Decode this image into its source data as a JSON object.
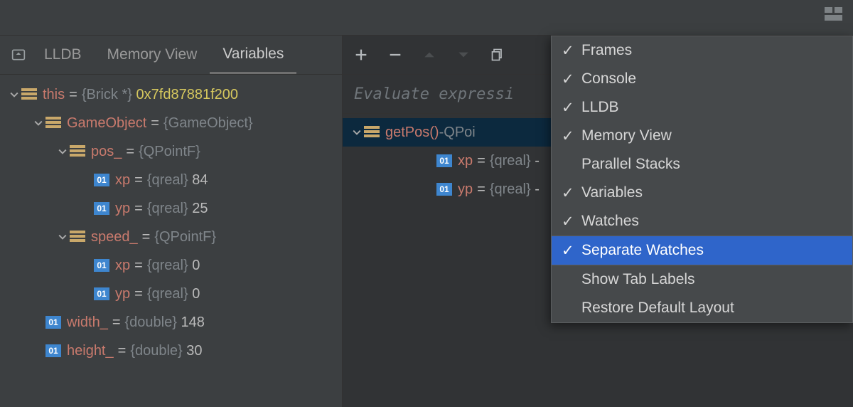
{
  "tabs": {
    "lldb": "LLDB",
    "memory": "Memory View",
    "variables": "Variables"
  },
  "eval_placeholder": "Evaluate expressi",
  "left_tree": {
    "this": {
      "name": "this",
      "type": "{Brick *}",
      "addr": "0x7fd87881f200"
    },
    "gameobj": {
      "name": "GameObject",
      "type": "{GameObject}"
    },
    "pos": {
      "name": "pos_",
      "type": "{QPointF}"
    },
    "pos_xp": {
      "name": "xp",
      "type": "{qreal}",
      "val": "84"
    },
    "pos_yp": {
      "name": "yp",
      "type": "{qreal}",
      "val": "25"
    },
    "speed": {
      "name": "speed_",
      "type": "{QPointF}"
    },
    "speed_xp": {
      "name": "xp",
      "type": "{qreal}",
      "val": "0"
    },
    "speed_yp": {
      "name": "yp",
      "type": "{qreal}",
      "val": "0"
    },
    "width": {
      "name": "width_",
      "type": "{double}",
      "val": "148"
    },
    "height": {
      "name": "height_",
      "type": "{double}",
      "val": "30"
    }
  },
  "right_tree": {
    "getpos": {
      "name": "getPos()",
      "sep": " - ",
      "ret": "QPoi",
      "tail": "oi"
    },
    "xp": {
      "name": "xp",
      "type": "{qreal}",
      "val": "-"
    },
    "yp": {
      "name": "yp",
      "type": "{qreal}",
      "val": "-"
    }
  },
  "menu": {
    "frames": "Frames",
    "console": "Console",
    "lldb": "LLDB",
    "memory": "Memory View",
    "parallel": "Parallel Stacks",
    "variables": "Variables",
    "watches": "Watches",
    "separate": "Separate Watches",
    "showtabs": "Show Tab Labels",
    "restore": "Restore Default Layout"
  },
  "prim_label": "01"
}
